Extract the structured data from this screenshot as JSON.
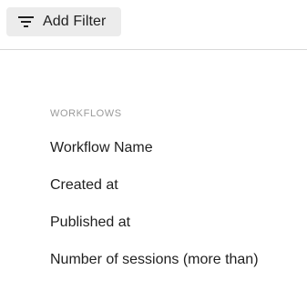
{
  "toolbar": {
    "add_filter_label": "Add Filter",
    "icon": "filter-lines-icon"
  },
  "menu": {
    "section_heading": "WORKFLOWS",
    "items": [
      {
        "label": "Workflow Name"
      },
      {
        "label": "Created at"
      },
      {
        "label": "Published at"
      },
      {
        "label": "Number of sessions (more than)"
      }
    ]
  },
  "colors": {
    "button_background": "#ececec",
    "divider": "#d9d9d9",
    "heading_text": "#9a9a9a",
    "body_text": "#1f1f1f"
  }
}
